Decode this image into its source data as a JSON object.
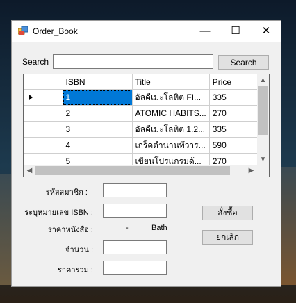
{
  "window": {
    "title": "Order_Book"
  },
  "search": {
    "label": "Search",
    "value": "",
    "button_label": "Search"
  },
  "grid": {
    "columns": [
      "ISBN",
      "Title",
      "Price"
    ],
    "rows": [
      {
        "isbn": "1",
        "title": "อัลคีเมะโลหิต FI...",
        "price": "335"
      },
      {
        "isbn": "2",
        "title": "ATOMIC HABITS...",
        "price": "270"
      },
      {
        "isbn": "3",
        "title": "อัลคีเมะโลหิต 1.2...",
        "price": "335"
      },
      {
        "isbn": "4",
        "title": "เกร็ดตำนานทึวาร...",
        "price": "590"
      },
      {
        "isbn": "5",
        "title": "เขียนโปรแกรมด้...",
        "price": "270"
      }
    ]
  },
  "form": {
    "member_id_label": "รหัสสมาชิก :",
    "isbn_label": "ระบุหมายเลข ISBN  :",
    "book_price_label": "ราคาหนังสือ :",
    "book_price_value": "-",
    "currency": "Bath",
    "quantity_label": "จำนวน :",
    "total_label": "ราคารวม :",
    "confirm_button": "สั่งซื้อ",
    "cancel_button": "ยกเลิก"
  }
}
